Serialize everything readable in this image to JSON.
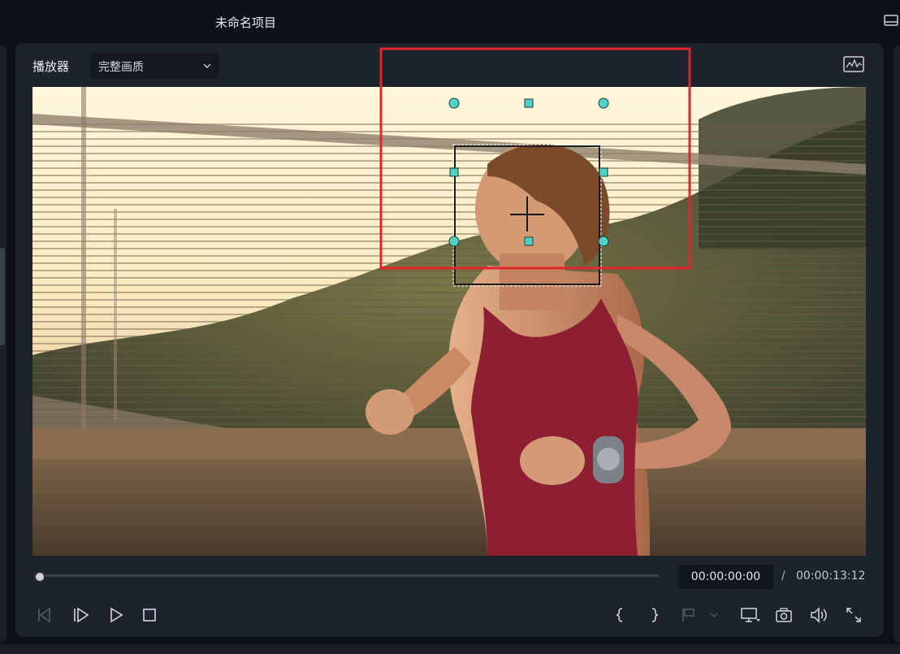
{
  "window": {
    "title": "未命名项目"
  },
  "player": {
    "label": "播放器",
    "quality": "完整画质"
  },
  "timecode": {
    "current": "00:00:00:00",
    "separator": "/",
    "total": "00:00:13:12"
  },
  "progress": {
    "fraction": 0.0
  },
  "icons": {
    "layout": "layout-icon",
    "scope": "waveform-scope-icon",
    "prev_frame": "prev-frame-icon",
    "next_frame": "next-frame-icon",
    "play": "play-icon",
    "stop": "stop-icon",
    "mark_in": "mark-in-icon",
    "mark_out": "mark-out-icon",
    "marker": "marker-icon",
    "display": "display-settings-icon",
    "snapshot": "camera-icon",
    "volume": "volume-icon",
    "fullscreen": "fullscreen-icon"
  },
  "colors": {
    "accent": "#4fd1c5",
    "highlight": "#e3242b",
    "tank_top": "#8e1f33"
  }
}
